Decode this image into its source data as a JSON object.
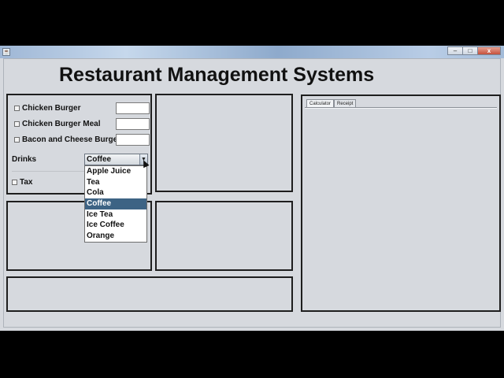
{
  "window": {
    "controls": {
      "minimize": "–",
      "maximize": "□",
      "close": "x"
    }
  },
  "app": {
    "title": "Restaurant Management Systems"
  },
  "menu_items": [
    {
      "label": "Chicken Burger"
    },
    {
      "label": "Chicken Burger Meal"
    },
    {
      "label": "Bacon and Cheese Burger"
    }
  ],
  "drinks": {
    "label": "Drinks",
    "selected": "Coffee",
    "options": [
      "Apple Juice",
      "Tea",
      "Cola",
      "Coffee",
      "Ice Tea",
      "Ice Coffee",
      "Orange"
    ]
  },
  "tax": {
    "label": "Tax"
  },
  "tabs": [
    {
      "label": "Calculator",
      "active": true
    },
    {
      "label": "Receipt",
      "active": false
    }
  ],
  "colors": {
    "selection": "#3d6384",
    "background": "#d6d9de",
    "border": "#1e1e1e"
  }
}
